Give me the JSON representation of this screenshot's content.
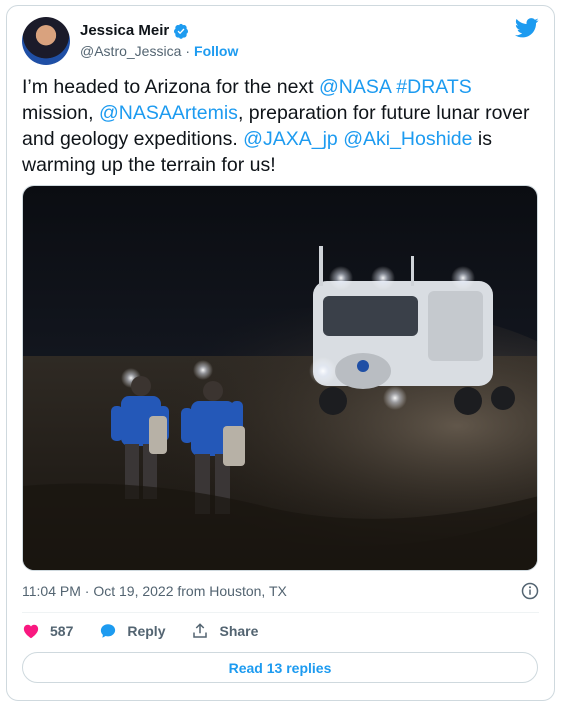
{
  "author": {
    "name": "Jessica Meir",
    "handle": "@Astro_Jessica",
    "separator": "·",
    "follow_label": "Follow"
  },
  "tweet": {
    "segments": [
      {
        "text": "I’m headed to Arizona for the next ",
        "link": false
      },
      {
        "text": "@NASA",
        "link": true
      },
      {
        "text": " ",
        "link": false
      },
      {
        "text": "#DRATS",
        "link": true
      },
      {
        "text": " mission, ",
        "link": false
      },
      {
        "text": "@NASAArtemis",
        "link": true
      },
      {
        "text": ", preparation for future lunar rover and geology expeditions. ",
        "link": false
      },
      {
        "text": "@JAXA_jp",
        "link": true
      },
      {
        "text": " ",
        "link": false
      },
      {
        "text": "@Aki_Hoshide",
        "link": true
      },
      {
        "text": " is warming up the terrain for us!",
        "link": false
      }
    ]
  },
  "meta": {
    "timestamp": "11:04 PM · Oct 19, 2022 from Houston, TX"
  },
  "actions": {
    "like_count": "587",
    "reply_label": "Reply",
    "share_label": "Share"
  },
  "replies_button": "Read 13 replies",
  "colors": {
    "brand": "#1d9bf0",
    "like": "#f91880",
    "border": "#cfd9de"
  }
}
